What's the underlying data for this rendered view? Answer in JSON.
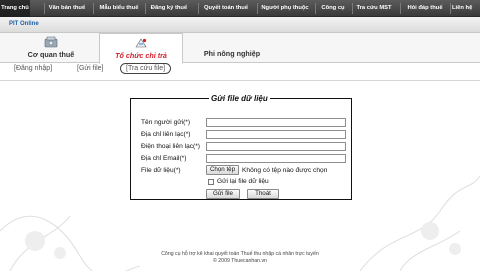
{
  "nav": {
    "items": [
      "Trang chủ",
      "Văn bản thuế",
      "Mẫu biểu thuế",
      "Đăng ký thuế",
      "Quyết toán thuế",
      "Người phụ thuộc",
      "Công cụ",
      "Tra cứu MST",
      "Hỏi đáp thuế",
      "Liên hệ"
    ]
  },
  "subbar": {
    "label": "PIT Online"
  },
  "tabs": {
    "tax_office": "Cơ quan thuế",
    "payer_org": "Tổ chức chi trả",
    "non_business": "Phi nông nghiệp"
  },
  "actions": {
    "login": "[Đăng nhập]",
    "send_file": "[Gửi file]",
    "lookup_file": "[Tra cứu file]"
  },
  "form": {
    "title": "Gửi file dữ liệu",
    "sender_name_label": "Tên người gửi(*)",
    "address_label": "Địa chỉ liên lạc(*)",
    "phone_label": "Điện thoại liên lạc(*)",
    "email_label": "Địa chỉ Email(*)",
    "file_label": "File dữ liệu(*)",
    "choose_file_button": "Chọn tệp",
    "no_file_text": "Không có tệp nào được chọn",
    "resend_label": "Gửi lại file dữ liệu",
    "submit_button": "Gửi file",
    "exit_button": "Thoát"
  },
  "footer": {
    "line1": "Công cụ hỗ trợ kê khai quyết toán Thuế thu nhập cá nhân trực tuyến",
    "line2": "© 2009 Thuecanhan.vn"
  }
}
